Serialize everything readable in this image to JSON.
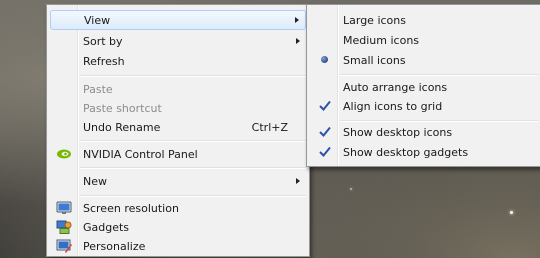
{
  "context_menu": {
    "items": [
      {
        "label": "View",
        "has_submenu": true
      },
      {
        "label": "Sort by",
        "has_submenu": true
      },
      {
        "label": "Refresh"
      },
      {
        "label": "Paste",
        "disabled": true
      },
      {
        "label": "Paste shortcut",
        "disabled": true
      },
      {
        "label": "Undo Rename",
        "shortcut": "Ctrl+Z"
      },
      {
        "label": "NVIDIA Control Panel",
        "icon": "nvidia-icon"
      },
      {
        "label": "New",
        "has_submenu": true
      },
      {
        "label": "Screen resolution",
        "icon": "screen-resolution-icon"
      },
      {
        "label": "Gadgets",
        "icon": "gadgets-icon"
      },
      {
        "label": "Personalize",
        "icon": "personalize-icon"
      }
    ]
  },
  "view_submenu": {
    "items": [
      {
        "label": "Large icons",
        "selected": false
      },
      {
        "label": "Medium icons",
        "selected": false
      },
      {
        "label": "Small icons",
        "selected": true,
        "mark": "radio-bullet"
      },
      {
        "label": "Auto arrange icons",
        "checked": false
      },
      {
        "label": "Align icons to grid",
        "checked": true
      },
      {
        "label": "Show desktop icons",
        "checked": true
      },
      {
        "label": "Show desktop gadgets",
        "checked": true
      }
    ]
  },
  "colors": {
    "menu_bg": "#f1f1f1",
    "highlight_border": "#aecff7",
    "check_color": "#2f52a6",
    "disabled_text": "#8d8d8d"
  }
}
